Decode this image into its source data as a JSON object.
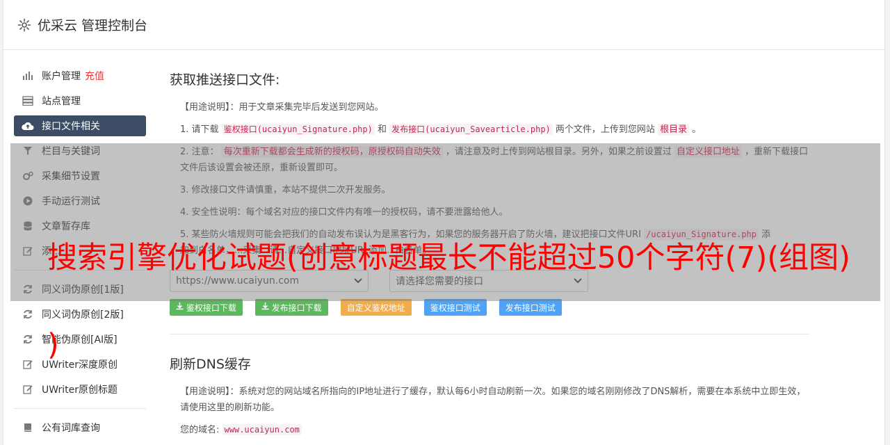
{
  "app": {
    "title": "优采云 管理控制台"
  },
  "sidebar": {
    "items": [
      {
        "label": "账户管理",
        "badge": "充值",
        "icon": "bar-chart-icon"
      },
      {
        "label": "站点管理",
        "icon": "server-icon"
      },
      {
        "label": "接口文件相关",
        "icon": "cloud-upload-icon",
        "active": true
      },
      {
        "label": "栏目与关键词",
        "icon": "filter-icon"
      },
      {
        "label": "采集细节设置",
        "icon": "cogs-icon"
      },
      {
        "label": "手动运行测试",
        "icon": "play-circle-icon"
      },
      {
        "label": "文章暂存库",
        "icon": "database-icon"
      },
      {
        "label": "添...",
        "icon": "edit-icon"
      }
    ],
    "items2": [
      {
        "label": "同义词伪原创[1版]",
        "icon": "refresh-icon"
      },
      {
        "label": "同义词伪原创[2版]",
        "icon": "refresh-icon"
      },
      {
        "label": "智能伪原创[AI版]",
        "icon": "refresh-icon"
      },
      {
        "label": "UWriter深度原创",
        "icon": "edit-icon"
      },
      {
        "label": "UWriter原创标题",
        "icon": "edit-icon"
      }
    ],
    "items3": [
      {
        "label": "公有词库查询",
        "icon": "book-icon"
      }
    ]
  },
  "section1": {
    "title": "获取推送接口文件:",
    "usage": "【用途说明】：用于文章采集完毕后发送到您网站。",
    "step1_prefix": "1. 请下载",
    "step1_link1": "鉴权接口(ucaiyun_Signature.php)",
    "step1_and": "和",
    "step1_link2": "发布接口(ucaiyun_Savearticle.php)",
    "step1_mid": "两个文件，上传到您网站",
    "step1_root": "根目录",
    "step1_end": "。",
    "step2_prefix": "2. 注意：",
    "step2_warn": "每次重新下载都会生成新的授权码，原授权码自动失效",
    "step2_mid": "，请注意及时上传到网站根目录。另外，如果之前设置过",
    "step2_link": "自定义接口地址",
    "step2_end": "，重新下载接口文件后该设置会被还原，重新设置即可。",
    "step3": "3. 修改接口文件请慎重，本站不提供二次开发服务。",
    "step4": "4. 安全性说明：每个域名对应的接口文件内有唯一的授权码，请不要泄露给他人。",
    "step5_prefix": "5. 某些防火墙规则可能会把我们的自动发布误认为是黑客行为，如果您的服务器开启了防火墙，建议把接口文件URI",
    "step5_code": "/ucaiyun_Signature.php",
    "step5_end": "添",
    "step5_line2": "加到白名单，...采集...请...自定义接口地址URL添加...白名单。",
    "select_domain": "https://www.ucaiyun.com",
    "select_api": "请选择您需要的接口",
    "buttons": {
      "download_sig": "鉴权接口下载",
      "download_pub": "发布接口下载",
      "custom": "自定义鉴权地址",
      "test_sig": "鉴权接口测试",
      "test_pub": "发布接口测试"
    }
  },
  "section2": {
    "title": "刷新DNS缓存",
    "usage": "【用途说明】：系统对您的网站域名所指向的IP地址进行了缓存，默认每6小时自动刷新一次。如果您的域名刚刚修改了DNS解析，需要在本系统中立即生效，请使用这里的刷新功能。",
    "domain_label": "您的域名:",
    "domain_value": "www.ucaiyun.com"
  },
  "watermark": {
    "line1": "搜索引擎优化试题(创意标题最长不能超过50个字符(7)(组图)",
    "line2": ")"
  },
  "colors": {
    "sidebar_active": "#3b4c64",
    "green": "#5cb85c",
    "orange": "#f0ad4e",
    "blue": "#5bc0de",
    "watermark": "#ff0000"
  }
}
